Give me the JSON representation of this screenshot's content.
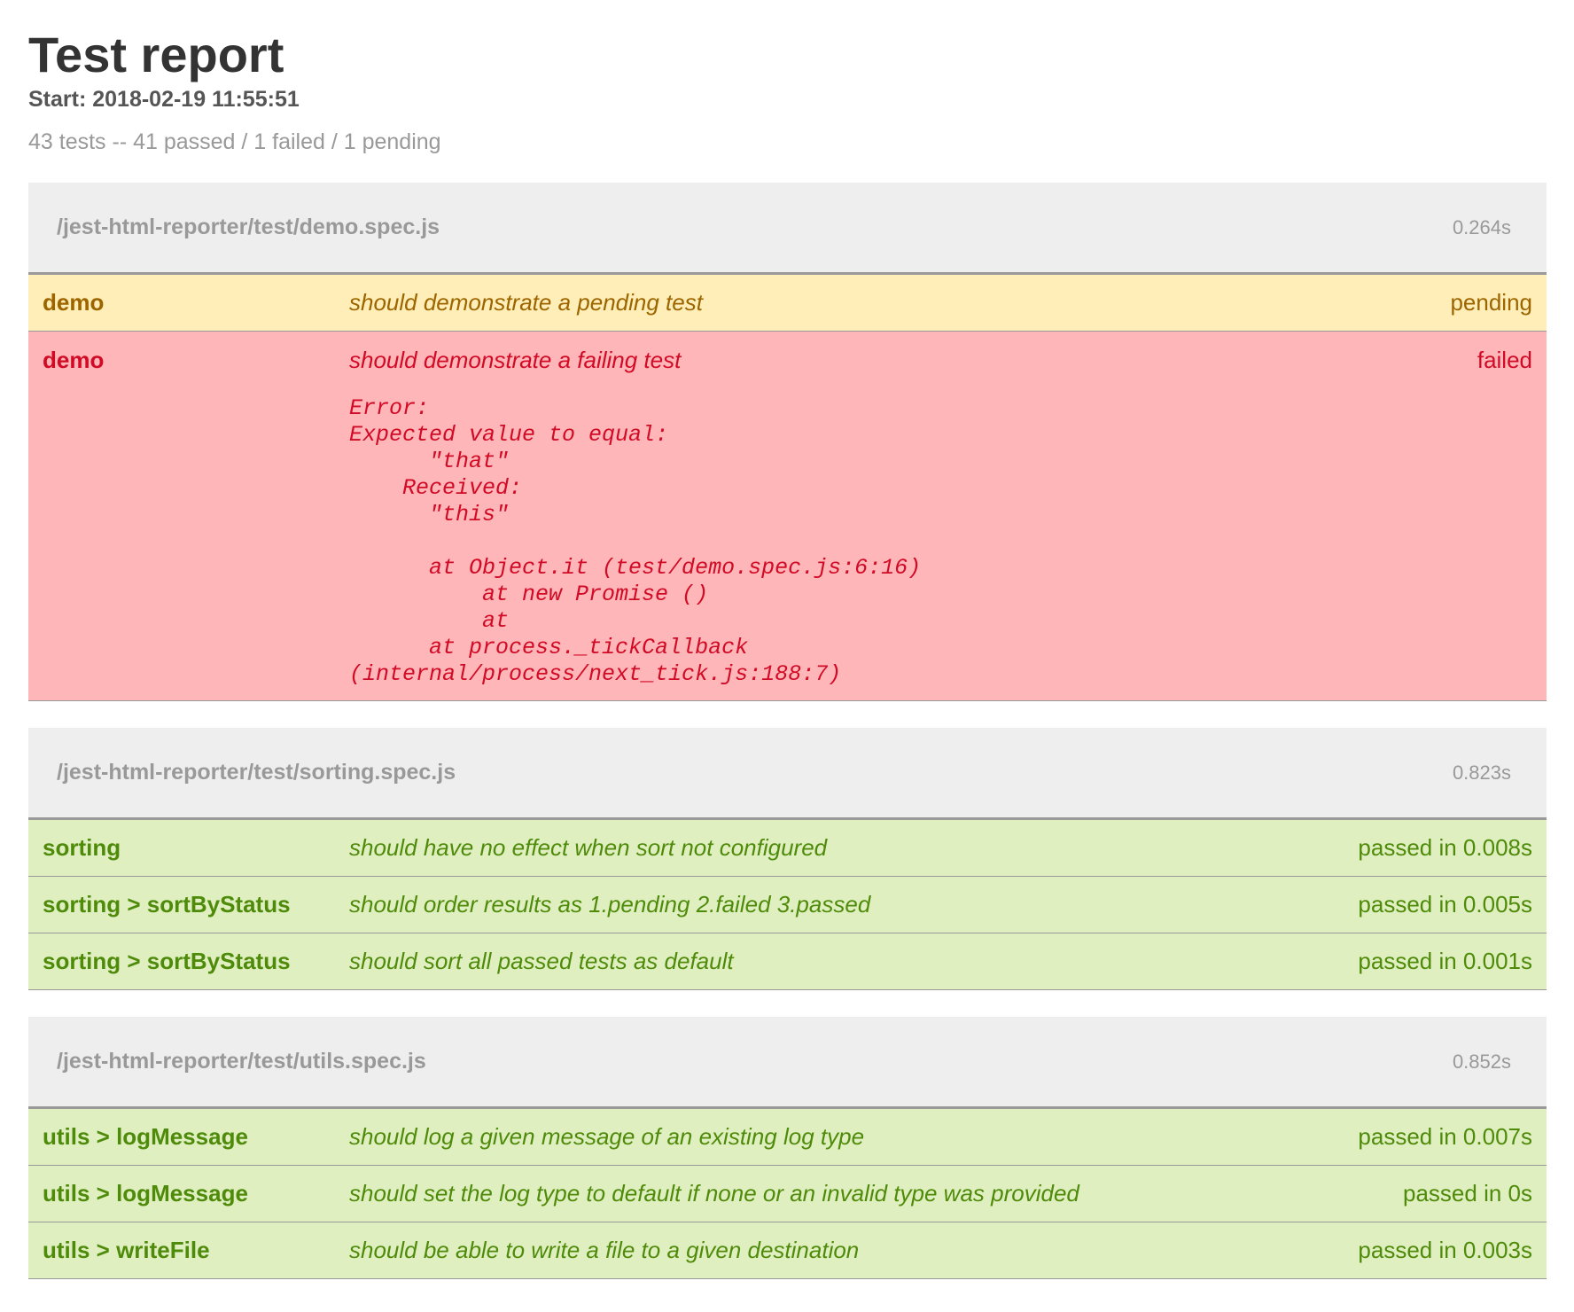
{
  "report": {
    "title": "Test report",
    "start": "Start: 2018-02-19 11:55:51",
    "summary": "43 tests -- 41 passed / 1 failed / 1 pending"
  },
  "suites": [
    {
      "path": "/jest-html-reporter/test/demo.spec.js",
      "time": "0.264s",
      "tests": [
        {
          "suite": "demo",
          "title": "should demonstrate a pending test",
          "status": "pending",
          "kind": "pending"
        },
        {
          "suite": "demo",
          "title": "should demonstrate a failing test",
          "status": "failed",
          "kind": "failed",
          "error": "Error:\nExpected value to equal:\n      \"that\"\n    Received:\n      \"this\"\n\n      at Object.it (test/demo.spec.js:6:16)\n          at new Promise ()\n          at\n      at process._tickCallback\n(internal/process/next_tick.js:188:7)"
        }
      ]
    },
    {
      "path": "/jest-html-reporter/test/sorting.spec.js",
      "time": "0.823s",
      "tests": [
        {
          "suite": "sorting",
          "title": "should have no effect when sort not configured",
          "status": "passed in 0.008s",
          "kind": "passed"
        },
        {
          "suite": "sorting > sortByStatus",
          "title": "should order results as 1.pending 2.failed 3.passed",
          "status": "passed in 0.005s",
          "kind": "passed"
        },
        {
          "suite": "sorting > sortByStatus",
          "title": "should sort all passed tests as default",
          "status": "passed in 0.001s",
          "kind": "passed"
        }
      ]
    },
    {
      "path": "/jest-html-reporter/test/utils.spec.js",
      "time": "0.852s",
      "tests": [
        {
          "suite": "utils > logMessage",
          "title": "should log a given message of an existing log type",
          "status": "passed in 0.007s",
          "kind": "passed"
        },
        {
          "suite": "utils > logMessage",
          "title": "should set the log type to default if none or an invalid type was provided",
          "status": "passed in 0s",
          "kind": "passed"
        },
        {
          "suite": "utils > writeFile",
          "title": "should be able to write a file to a given destination",
          "status": "passed in 0.003s",
          "kind": "passed"
        }
      ]
    }
  ]
}
